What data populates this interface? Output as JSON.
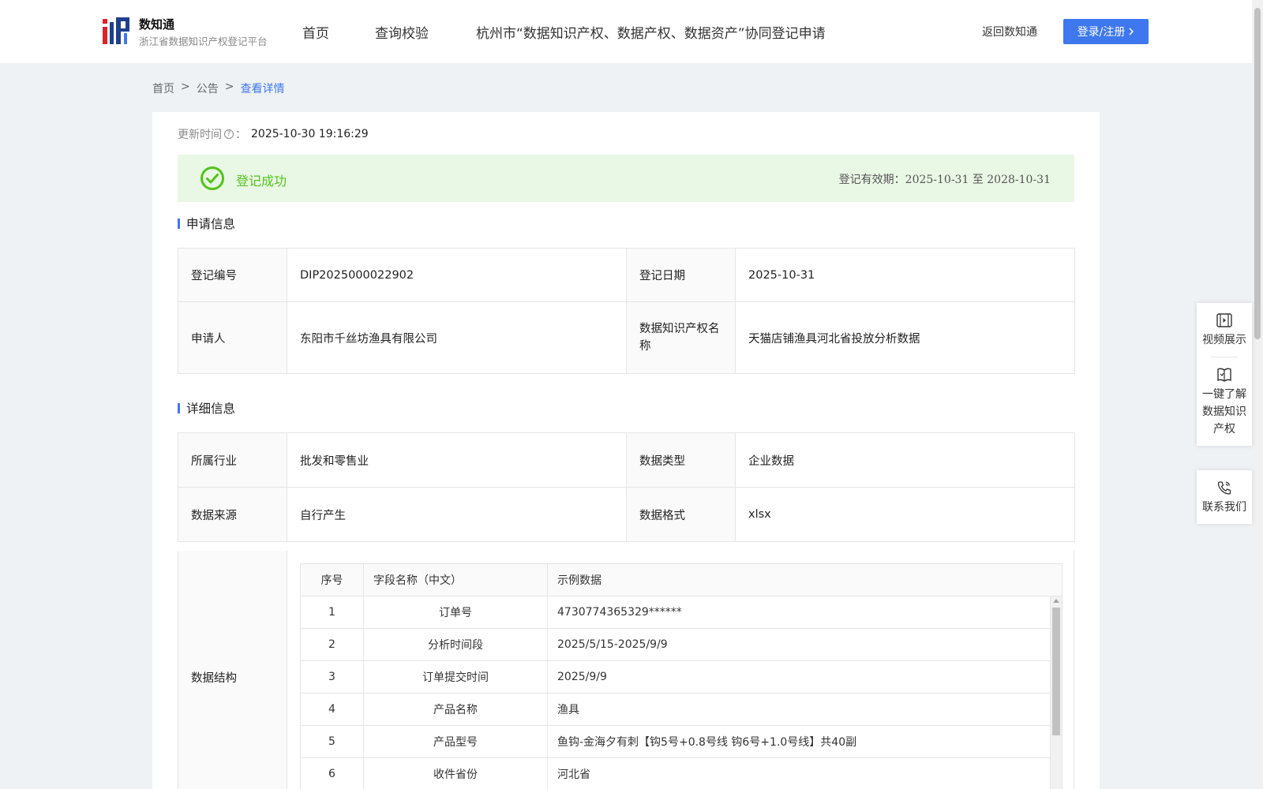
{
  "header": {
    "logo_title": "数知通",
    "logo_subtitle": "浙江省数据知识产权登记平台",
    "nav": [
      "首页",
      "查询校验",
      "杭州市“数据知识产权、数据产权、数据资产”协同登记申请"
    ],
    "return_link": "返回数知通",
    "login_label": "登录/注册",
    "accent_color": "#3e77ee"
  },
  "breadcrumb": {
    "items": [
      "首页",
      "公告"
    ],
    "separator": ">",
    "current": "查看详情"
  },
  "update": {
    "label": "更新时间",
    "colon": "：",
    "value": "2025-10-30 19:16:29"
  },
  "status": {
    "text": "登记成功",
    "validity_label": "登记有效期：",
    "validity_value": "2025-10-31 至 2028-10-31",
    "color": "#52c41a"
  },
  "application": {
    "title": "申请信息",
    "rows": [
      {
        "k1": "登记编号",
        "v1": "DIP2025000022902",
        "k2": "登记日期",
        "v2": "2025-10-31"
      },
      {
        "k1": "申请人",
        "v1": "东阳市千丝坊渔具有限公司",
        "k2": "数据知识产权名称",
        "v2": "天猫店铺渔具河北省投放分析数据"
      }
    ]
  },
  "detail": {
    "title": "详细信息",
    "rows": [
      {
        "k1": "所属行业",
        "v1": "批发和零售业",
        "k2": "数据类型",
        "v2": "企业数据"
      },
      {
        "k1": "数据来源",
        "v1": "自行产生",
        "k2": "数据格式",
        "v2": "xlsx"
      }
    ],
    "structure_label": "数据结构",
    "structure_headers": [
      "序号",
      "字段名称（中文）",
      "示例数据"
    ],
    "structure_rows": [
      {
        "no": "1",
        "name": "订单号",
        "sample": "4730774365329******"
      },
      {
        "no": "2",
        "name": "分析时间段",
        "sample": "2025/5/15-2025/9/9"
      },
      {
        "no": "3",
        "name": "订单提交时间",
        "sample": "2025/9/9"
      },
      {
        "no": "4",
        "name": "产品名称",
        "sample": "渔具"
      },
      {
        "no": "5",
        "name": "产品型号",
        "sample": "鱼钩-金海夕有刺【钩5号+0.8号线 钩6号+1.0号线】共40副"
      },
      {
        "no": "6",
        "name": "收件省份",
        "sample": "河北省"
      }
    ]
  },
  "side_panel": {
    "items": [
      "视频展示",
      "一键了解数据知识产权",
      "联系我们"
    ],
    "item2_lines": [
      "一键了解",
      "数据知识",
      "产权"
    ]
  }
}
